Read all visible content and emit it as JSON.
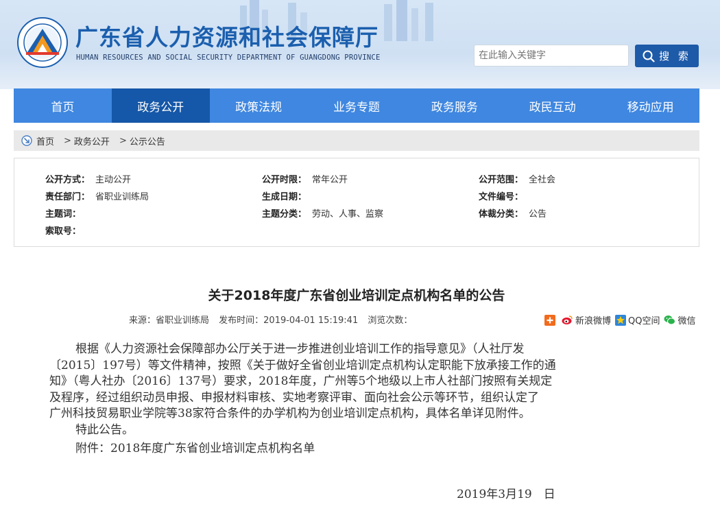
{
  "header": {
    "title": "广东省人力资源和社会保障厅",
    "subtitle": "HUMAN RESOURCES AND SOCIAL SECURITY DEPARTMENT OF GUANGDONG PROVINCE",
    "search_placeholder": "在此输入关键字",
    "search_label": "搜 索"
  },
  "nav": {
    "items": [
      "首页",
      "政务公开",
      "政策法规",
      "业务专题",
      "政务服务",
      "政民互动",
      "移动应用"
    ],
    "active_index": 1
  },
  "breadcrumb": {
    "items": [
      "首页",
      "政务公开",
      "公示公告"
    ],
    "separator": ">"
  },
  "meta": {
    "rows": [
      [
        {
          "label": "公开方式：",
          "value": "主动公开"
        },
        {
          "label": "公开时限：",
          "value": "常年公开"
        },
        {
          "label": "公开范围：",
          "value": "全社会"
        }
      ],
      [
        {
          "label": "责任部门：",
          "value": "省职业训练局"
        },
        {
          "label": "生成日期：",
          "value": ""
        },
        {
          "label": "文件编号：",
          "value": ""
        }
      ],
      [
        {
          "label": "主题词：",
          "value": ""
        },
        {
          "label": "主题分类：",
          "value": "劳动、人事、监察"
        },
        {
          "label": "体裁分类：",
          "value": "公告"
        }
      ],
      [
        {
          "label": "索取号：",
          "value": ""
        }
      ]
    ]
  },
  "article": {
    "title": "关于2018年度广东省创业培训定点机构名单的公告",
    "source": "来源：省职业训练局",
    "published": "发布时间：2019-04-01 15:19:41",
    "views": "浏览次数：",
    "share": {
      "weibo": "新浪微博",
      "qzone": "QQ空间",
      "wechat": "微信"
    },
    "para1_lines": [
      "根据《人力资源社会保障部办公厅关于进一步推进创业培训工作的指导意见》（人社厅发",
      "〔2015〕197号）等文件精神，按照《关于做好全省创业培训定点机构认定职能下放承接工作的通",
      "知》（粤人社办〔2016〕137号）要求，2018年度，广州等5个地级以上市人社部门按照有关规定",
      "及程序，经过组织动员申报、申报材料审核、实地考察评审、面向社会公示等环节，组织认定了",
      "广州科技贸易职业学院等38家符合条件的办学机构为创业培训定点机构，具体名单详见附件。"
    ],
    "para2": "特此公告。",
    "attachment": "附件：2018年度广东省创业培训定点机构名单",
    "date": "2019年3月19　日"
  },
  "colors": {
    "nav_bg": "#3f87e0",
    "nav_active": "#1557a8",
    "title_blue": "#1b5fae",
    "search_btn": "#1d5aa8"
  }
}
